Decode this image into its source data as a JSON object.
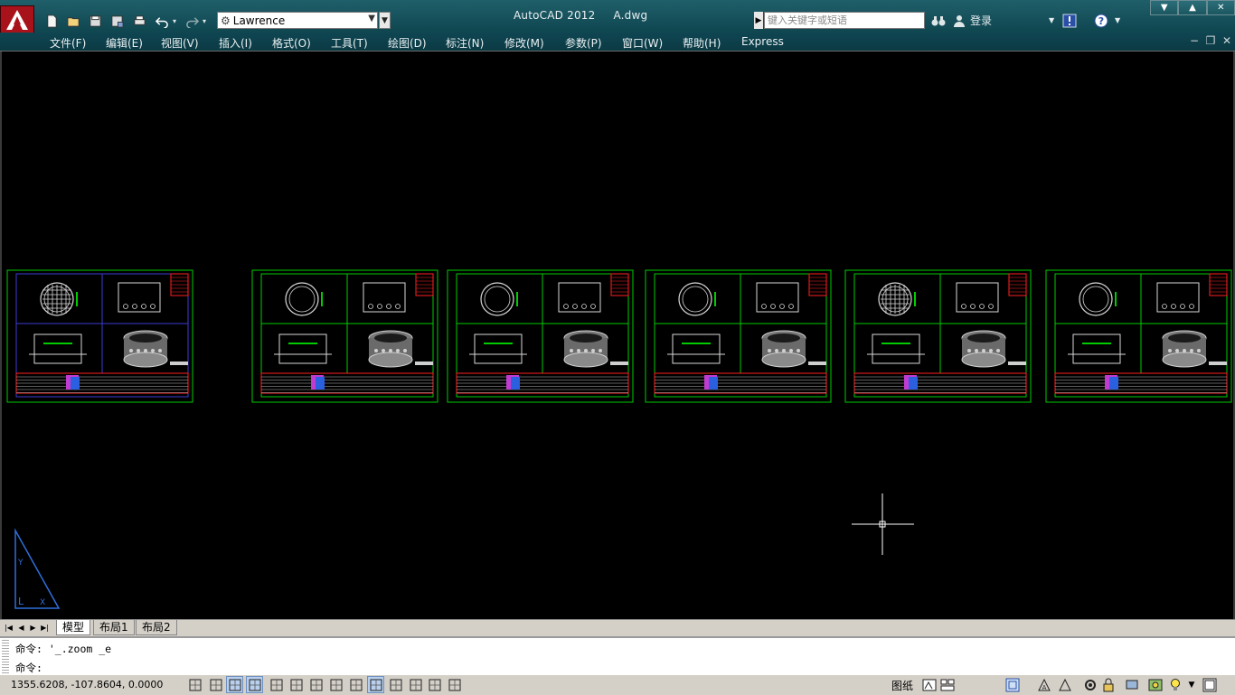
{
  "titlebar": {
    "app_name": "AutoCAD 2012",
    "document_name": "A.dwg",
    "workspace": "Lawrence",
    "search_placeholder": "键入关键字或短语",
    "login_label": "登录"
  },
  "menubar": {
    "items": [
      "文件(F)",
      "编辑(E)",
      "视图(V)",
      "插入(I)",
      "格式(O)",
      "工具(T)",
      "绘图(D)",
      "标注(N)",
      "修改(M)",
      "参数(P)",
      "窗口(W)",
      "帮助(H)",
      "Express"
    ]
  },
  "layout_tabs": {
    "items": [
      "模型",
      "布局1",
      "布局2"
    ],
    "active": "模型"
  },
  "command_line": {
    "history": "命令: '_.zoom _e",
    "prompt": "命令:"
  },
  "statusbar": {
    "coordinates": "1355.6208, -107.8604, 0.0000",
    "space_label": "图纸"
  },
  "colors": {
    "titlebar": "#1a5862",
    "canvas": "#000000",
    "frame_green": "#00cc00",
    "frame_blue": "#3b3bd6",
    "title_red": "#ff2020",
    "ucs_blue": "#2f6fdb"
  },
  "icons": {
    "quick_access": [
      "new-icon",
      "open-icon",
      "save-icon",
      "save-as-icon",
      "plot-icon",
      "undo-icon",
      "redo-icon"
    ],
    "title_right": [
      "binoculars-icon",
      "user-icon",
      "exchange-icon",
      "help-icon"
    ],
    "status": [
      "infer-constraints-icon",
      "snap-icon",
      "grid-icon",
      "ortho-icon",
      "polar-icon",
      "osnap-icon",
      "3d-osnap-icon",
      "otrack-icon",
      "ducs-icon",
      "dyn-icon",
      "lineweight-icon",
      "transparency-icon",
      "quick-properties-icon",
      "selection-cycling-icon"
    ]
  }
}
